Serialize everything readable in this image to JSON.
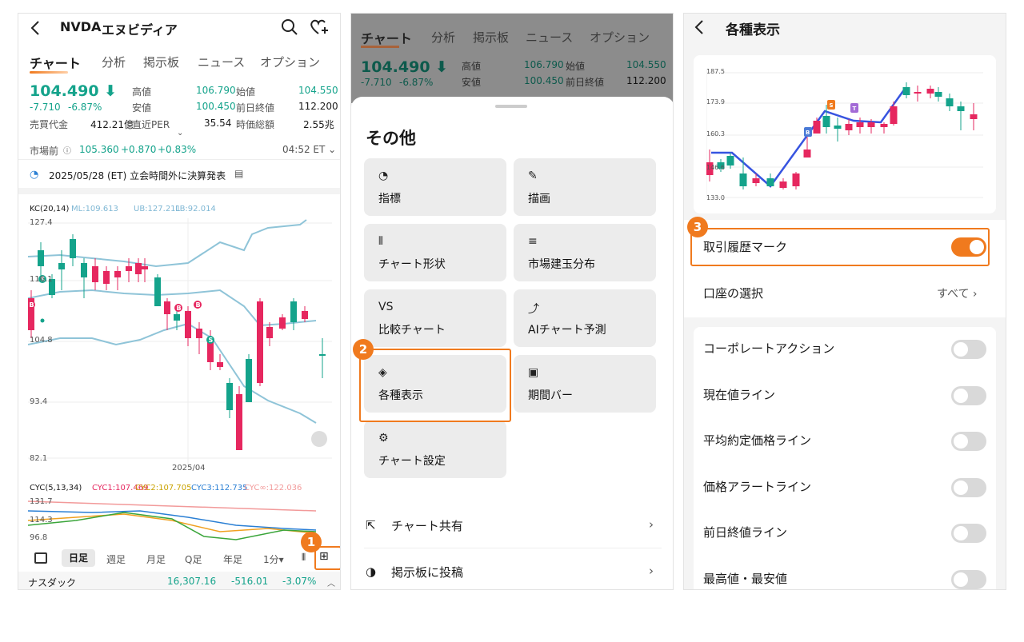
{
  "p1": {
    "ticker": "NVDA",
    "name": "エヌビディア",
    "tabs": [
      "チャート",
      "分析",
      "掲示板",
      "ニュース",
      "オプション"
    ],
    "price": "104.490",
    "change": "-7.710",
    "change_pct": "-6.87%",
    "stats": [
      {
        "l": "高値",
        "v": "106.790",
        "l2": "始値",
        "v2": "104.550"
      },
      {
        "l": "安値",
        "v": "100.450",
        "l2": "前日終値",
        "v2": "112.200"
      },
      {
        "l": "売買代金",
        "v": "412.21億",
        "l2": "直近PER",
        "v2": "35.54",
        "l3": "時価総額",
        "v3": "2.55兆"
      }
    ],
    "premarket": {
      "label": "市場前",
      "price": "105.360",
      "change": "+0.870",
      "pct": "+0.83%",
      "time": "04:52 ET"
    },
    "event": "2025/05/28 (ET)  立会時間外に決算発表",
    "kc": {
      "label": "KC(20,14)",
      "ml": "ML:109.613",
      "ub": "UB:127.211",
      "lb": "LB:92.014"
    },
    "yticks": [
      "127.4",
      "116.1",
      "104.8",
      "93.4",
      "82.1"
    ],
    "xdate": "2025/04",
    "cyc": {
      "label": "CYC(5,13,34)",
      "c1": "CYC1:107.469",
      "c2": "CYC2:107.705",
      "c3": "CYC3:112.735",
      "ci": "CYC∞:122.036"
    },
    "cyc_ticks": [
      "131.7",
      "114.3",
      "96.8"
    ],
    "periods": [
      "日足",
      "週足",
      "月足",
      "Q足",
      "年足",
      "1分▾"
    ],
    "index": {
      "name": "ナスダック",
      "value": "16,307.16",
      "change": "-516.01",
      "pct": "-3.07%"
    }
  },
  "p2": {
    "tabs": [
      "チャート",
      "分析",
      "掲示板",
      "ニュース",
      "オプション"
    ],
    "price": "104.490",
    "change": "-7.710",
    "change_pct": "-6.87%",
    "stats": [
      {
        "l": "高値",
        "v": "106.790",
        "l2": "始値",
        "v2": "104.550"
      },
      {
        "l": "安値",
        "v": "100.450",
        "l2": "前日終値",
        "v2": "112.200"
      }
    ],
    "sheet_title": "その他",
    "cards": [
      "指標",
      "描画",
      "チャート形状",
      "市場建玉分布",
      "比較チャート",
      "AIチャート予測",
      "各種表示",
      "期間バー",
      "チャート設定"
    ],
    "vs": "VS",
    "list": [
      "チャート共有",
      "掲示板に投稿"
    ]
  },
  "p3": {
    "title": "各種表示",
    "yticks": [
      "187.5",
      "173.9",
      "160.3",
      "146.6",
      "133.0"
    ],
    "trade_mark": "取引履歴マーク",
    "account": "口座の選択",
    "account_val": "すべて",
    "toggles": [
      "コーポレートアクション",
      "現在値ライン",
      "平均約定価格ライン",
      "価格アラートライン",
      "前日終値ライン",
      "最高値・最安値"
    ]
  },
  "badges": [
    "1",
    "2",
    "3"
  ],
  "colors": {
    "up": "#14a38b",
    "down": "#e6275f",
    "accent": "#f07a1e"
  }
}
